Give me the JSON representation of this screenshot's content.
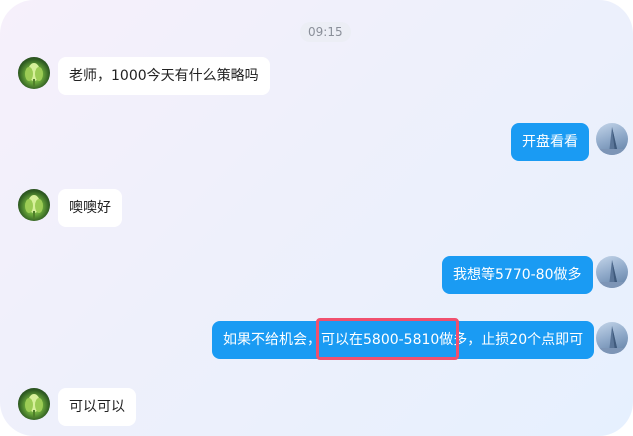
{
  "chat": {
    "timestamp": "09:15",
    "messages": [
      {
        "sender": "teacher",
        "text": "老师，1000今天有什么策略吗"
      },
      {
        "sender": "me",
        "text": "开盘看看"
      },
      {
        "sender": "teacher",
        "text": "噢噢好"
      },
      {
        "sender": "me",
        "text": "我想等5770-80做多"
      },
      {
        "sender": "me",
        "text": "如果不给机会，可以在5800-5810做多，止损20个点即可"
      },
      {
        "sender": "teacher",
        "text": "可以可以"
      }
    ]
  },
  "colors": {
    "sent_bubble": "#1a9bf3",
    "received_bubble": "#ffffff",
    "highlight": "#f0506e"
  },
  "icons": {
    "teacher_avatar": "green-flower-avatar",
    "my_avatar": "building-avatar"
  }
}
